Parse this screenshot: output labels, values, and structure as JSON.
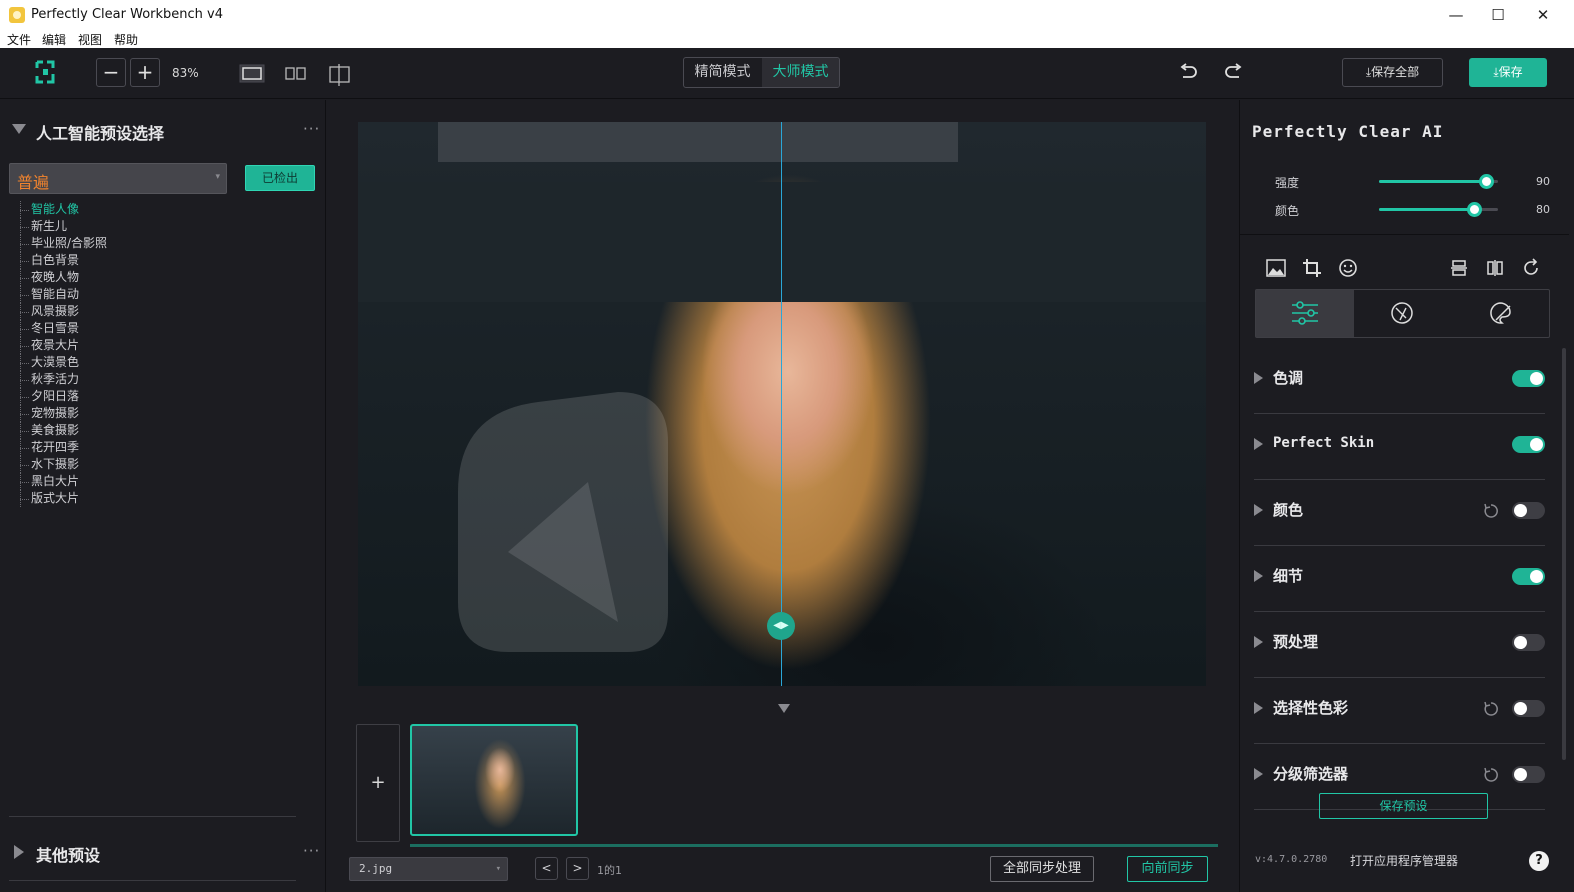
{
  "window": {
    "title": "Perfectly Clear Workbench v4",
    "minimize": "—",
    "maximize": "☐",
    "close": "✕"
  },
  "menu": [
    "文件",
    "编辑",
    "视图",
    "帮助"
  ],
  "toolbar": {
    "zoom_out": "−",
    "zoom_in": "+",
    "zoom_value": "83%",
    "mode_simple": "精简模式",
    "mode_master": "大师模式",
    "save_all": "保存全部",
    "save": "保存"
  },
  "left_panel": {
    "ai_presets_title": "人工智能预设选择",
    "more": "···",
    "preset_selected": "普遍",
    "detected_button": "已检出",
    "presets": [
      "智能人像",
      "新生儿",
      "毕业照/合影照",
      "白色背景",
      "夜晚人物",
      "智能自动",
      "风景摄影",
      "冬日雪景",
      "夜景大片",
      "大漠景色",
      "秋季活力",
      "夕阳日落",
      "宠物摄影",
      "美食摄影",
      "花开四季",
      "水下摄影",
      "黑白大片",
      "版式大片"
    ],
    "active_preset": "智能人像",
    "other_presets_title": "其他预设"
  },
  "center": {
    "add_image": "+",
    "file_name": "2.jpg",
    "prev": "<",
    "next": ">",
    "page_info": "1的1",
    "sync_all": "全部同步处理",
    "sync_forward": "向前同步",
    "compare_handle": "◀▶"
  },
  "right_panel": {
    "title": "Perfectly Clear AI",
    "sliders": [
      {
        "label": "强度",
        "value": "90",
        "fraction": 0.9
      },
      {
        "label": "颜色",
        "value": "80",
        "fraction": 0.8
      }
    ],
    "sections": [
      {
        "label": "色调",
        "on": true,
        "reset": false,
        "mono": false
      },
      {
        "label": "Perfect Skin",
        "on": true,
        "reset": false,
        "mono": true
      },
      {
        "label": "颜色",
        "on": false,
        "reset": true,
        "mono": false
      },
      {
        "label": "细节",
        "on": true,
        "reset": false,
        "mono": false
      },
      {
        "label": "预处理",
        "on": false,
        "reset": false,
        "mono": false
      },
      {
        "label": "选择性色彩",
        "on": false,
        "reset": true,
        "mono": false
      },
      {
        "label": "分级筛选器",
        "on": false,
        "reset": true,
        "mono": false
      }
    ],
    "save_preset": "保存预设",
    "version": "v:4.7.0.2780",
    "app_manager": "打开应用程序管理器",
    "help": "?"
  },
  "colors": {
    "accent": "#21c6a6",
    "accent_button": "#1fb496",
    "preset_text": "#f0832e",
    "background": "#1c1c21"
  }
}
